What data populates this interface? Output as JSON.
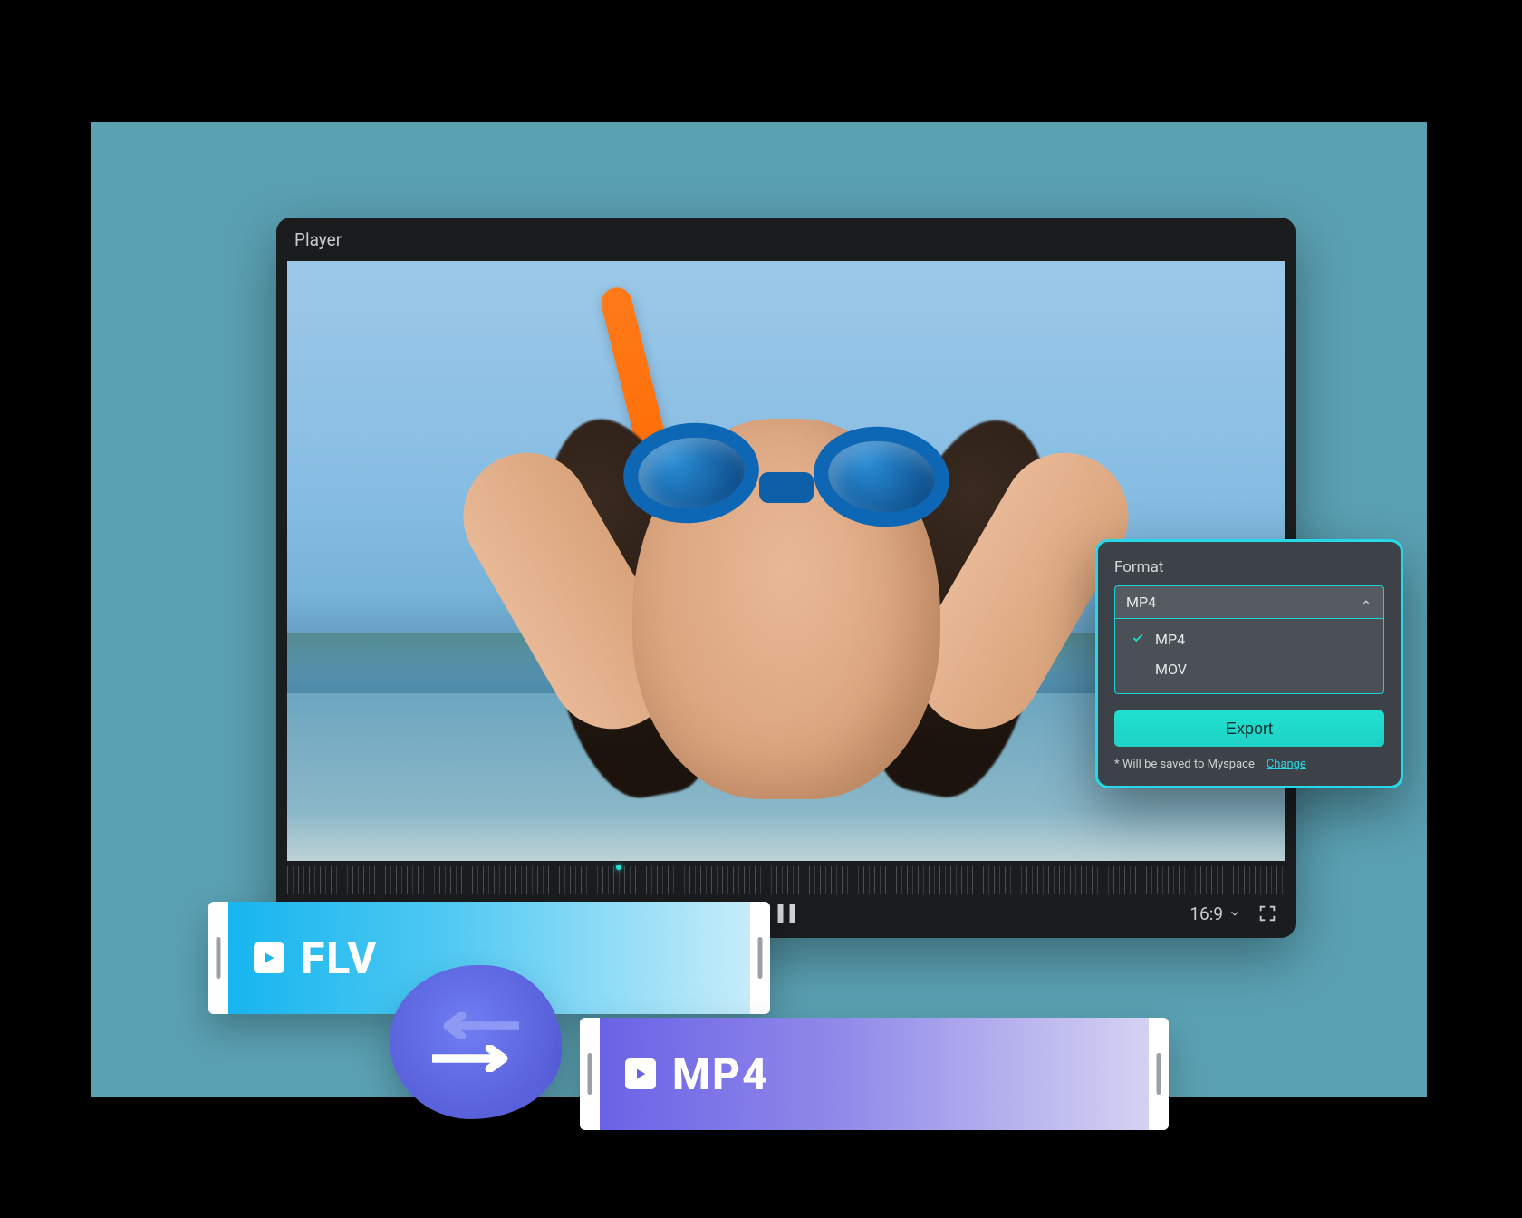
{
  "player": {
    "title": "Player",
    "aspect_ratio": "16:9"
  },
  "export_panel": {
    "label": "Format",
    "selected": "MP4",
    "options": [
      "MP4",
      "MOV"
    ],
    "button": "Export",
    "note_prefix": "* Will be saved to Myspace",
    "note_link": "Change"
  },
  "chips": {
    "flv": "FLV",
    "mp4": "MP4"
  }
}
